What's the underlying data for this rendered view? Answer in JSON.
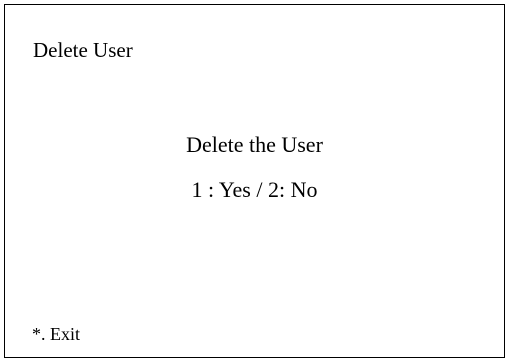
{
  "screen": {
    "title": "Delete User",
    "message": "Delete the User",
    "options": "1 : Yes / 2: No",
    "exit_label": "*. Exit"
  },
  "colors": {
    "background": "#ffffff",
    "text": "#000000",
    "border": "#000000"
  }
}
